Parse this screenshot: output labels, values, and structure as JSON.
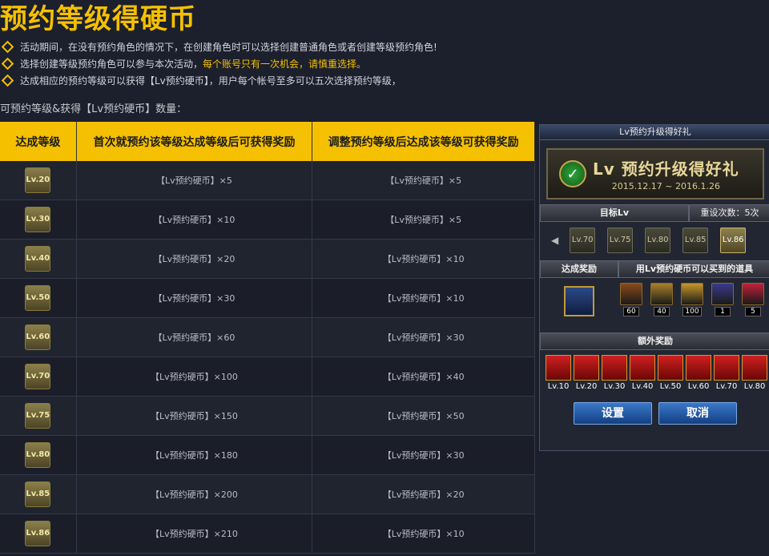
{
  "title": "预约等级得硬币",
  "notes": [
    {
      "text": "活动期间，在没有预约角色的情况下，在创建角色时可以选择创建普通角色或者创建等级预约角色!",
      "highlight": ""
    },
    {
      "text": "选择创建等级预约角色可以参与本次活动，",
      "highlight": "每个账号只有一次机会，请慎重选择。"
    },
    {
      "text": "达成相应的预约等级可以获得【Lv预约硬币】，用户每个帐号至多可以五次选择预约等级，",
      "highlight": ""
    }
  ],
  "subtitle": "可预约等级&获得【Lv预约硬币】数量：",
  "table": {
    "headers": [
      "达成等级",
      "首次就预约该等级达成等级后可获得奖励",
      "调整预约等级后达成该等级可获得奖励"
    ],
    "rows": [
      {
        "lv": "Lv.20",
        "first": "【Lv预约硬币】×5",
        "adjusted": "【Lv预约硬币】×5"
      },
      {
        "lv": "Lv.30",
        "first": "【Lv预约硬币】×10",
        "adjusted": "【Lv预约硬币】×5"
      },
      {
        "lv": "Lv.40",
        "first": "【Lv预约硬币】×20",
        "adjusted": "【Lv预约硬币】×10"
      },
      {
        "lv": "Lv.50",
        "first": "【Lv预约硬币】×30",
        "adjusted": "【Lv预约硬币】×10"
      },
      {
        "lv": "Lv.60",
        "first": "【Lv预约硬币】×60",
        "adjusted": "【Lv预约硬币】×30"
      },
      {
        "lv": "Lv.70",
        "first": "【Lv预约硬币】×100",
        "adjusted": "【Lv预约硬币】×40"
      },
      {
        "lv": "Lv.75",
        "first": "【Lv预约硬币】×150",
        "adjusted": "【Lv预约硬币】×50"
      },
      {
        "lv": "Lv.80",
        "first": "【Lv预约硬币】×180",
        "adjusted": "【Lv预约硬币】×30"
      },
      {
        "lv": "Lv.85",
        "first": "【Lv预约硬币】×200",
        "adjusted": "【Lv预约硬币】×20"
      },
      {
        "lv": "Lv.86",
        "first": "【Lv预约硬币】×210",
        "adjusted": "【Lv预约硬币】×10"
      }
    ]
  },
  "panel": {
    "title": "Lv预约升级得好礼",
    "banner_title": "Lv 预约升级得好礼",
    "banner_date": "2015.12.17 ~ 2016.1.26",
    "target_label": "目标Lv",
    "reset_label": "重设次数：5次",
    "levels": [
      "Lv.70",
      "Lv.75",
      "Lv.80",
      "Lv.85",
      "Lv.86"
    ],
    "selected_level": "Lv.86",
    "reward_label": "达成奖励",
    "shop_label": "用Lv预约硬币可以买到的道具",
    "main_reward_icon": "coin-icon",
    "shop_items": [
      {
        "icon": "treasure-book-icon",
        "count": "60",
        "color": "#8a4a1a"
      },
      {
        "icon": "chest-icon",
        "count": "40",
        "color": "#a8802a"
      },
      {
        "icon": "golden-chest-icon",
        "count": "100",
        "color": "#c7962a"
      },
      {
        "icon": "potion-icon",
        "count": "1",
        "color": "#3a3a8a"
      },
      {
        "icon": "gift-box-icon",
        "count": "5",
        "color": "#c0203a"
      }
    ],
    "extra_label": "额外奖励",
    "extra_rewards": [
      "Lv.10",
      "Lv.20",
      "Lv.30",
      "Lv.40",
      "Lv.50",
      "Lv.60",
      "Lv.70",
      "Lv.80"
    ],
    "confirm_label": "设置",
    "cancel_label": "取消"
  }
}
